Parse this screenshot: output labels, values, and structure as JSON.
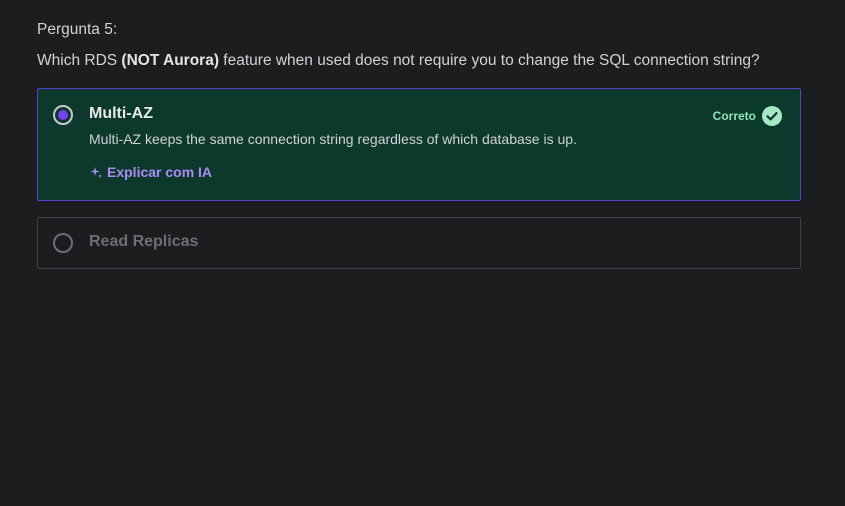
{
  "question": {
    "number_label": "Pergunta 5:",
    "text_before": "Which RDS ",
    "text_bold": "(NOT Aurora)",
    "text_after": " feature when used does not require you to change the SQL connection string?"
  },
  "options": [
    {
      "label": "Multi-AZ",
      "selected": true,
      "status_label": "Correto",
      "status_icon": "check-circle-icon",
      "explanation": "Multi-AZ keeps the same connection string regardless of which database is up.",
      "explain_link": "Explicar com IA",
      "explain_icon": "sparkle-icon"
    },
    {
      "label": "Read Replicas",
      "selected": false
    }
  ],
  "colors": {
    "background": "#1c1d1f",
    "correct_bg": "#0d382c",
    "correct_border": "#5b3dd6",
    "radio_dot": "#7b3ff2",
    "link": "#a98bf6",
    "success": "#a3e9c4"
  }
}
